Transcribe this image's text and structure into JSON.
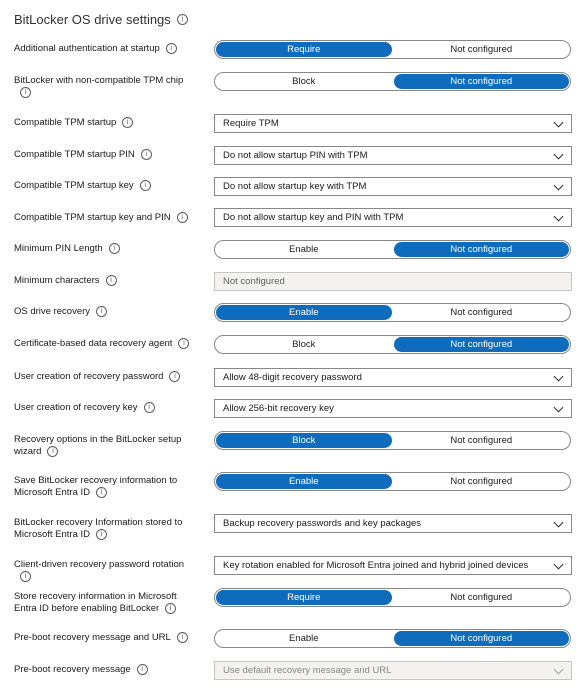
{
  "section": {
    "title": "BitLocker OS drive settings"
  },
  "rows": [
    {
      "label": "Additional authentication at startup",
      "type": "toggle",
      "options": [
        "Require",
        "Not configured"
      ],
      "selected": 0
    },
    {
      "label": "BitLocker with non-compatible TPM chip",
      "type": "toggle",
      "options": [
        "Block",
        "Not configured"
      ],
      "selected": 1
    },
    {
      "label": "Compatible TPM startup",
      "type": "select",
      "value": "Require TPM"
    },
    {
      "label": "Compatible TPM startup PIN",
      "type": "select",
      "value": "Do not allow startup PIN with TPM"
    },
    {
      "label": "Compatible TPM startup key",
      "type": "select",
      "value": "Do not allow startup key with TPM"
    },
    {
      "label": "Compatible TPM startup key and PIN",
      "type": "select",
      "value": "Do not allow startup key and PIN with TPM"
    },
    {
      "label": "Minimum PIN Length",
      "type": "toggle",
      "options": [
        "Enable",
        "Not configured"
      ],
      "selected": 1
    },
    {
      "label": "Minimum characters",
      "type": "textbox",
      "value": "Not configured"
    },
    {
      "label": "OS drive recovery",
      "type": "toggle",
      "options": [
        "Enable",
        "Not configured"
      ],
      "selected": 0
    },
    {
      "label": "Certificate-based data recovery agent",
      "type": "toggle",
      "options": [
        "Block",
        "Not configured"
      ],
      "selected": 1
    },
    {
      "label": "User creation of recovery password",
      "type": "select",
      "value": "Allow 48-digit recovery password"
    },
    {
      "label": "User creation of recovery key",
      "type": "select",
      "value": "Allow 256-bit recovery key"
    },
    {
      "label": "Recovery options in the BitLocker setup wizard",
      "type": "toggle",
      "options": [
        "Block",
        "Not configured"
      ],
      "selected": 0
    },
    {
      "label": "Save BitLocker recovery information to Microsoft Entra ID",
      "type": "toggle",
      "options": [
        "Enable",
        "Not configured"
      ],
      "selected": 0
    },
    {
      "label": "BitLocker recovery Information stored to Microsoft Entra ID",
      "type": "select",
      "value": "Backup recovery passwords and key packages"
    },
    {
      "label": "Client-driven recovery password rotation",
      "type": "select",
      "value": "Key rotation enabled for Microsoft Entra joined and hybrid joined devices"
    },
    {
      "label": "Store recovery information in Microsoft Entra ID before enabling BitLocker",
      "type": "toggle",
      "options": [
        "Require",
        "Not configured"
      ],
      "selected": 0
    },
    {
      "label": "Pre-boot recovery message and URL",
      "type": "toggle",
      "options": [
        "Enable",
        "Not configured"
      ],
      "selected": 1
    },
    {
      "label": "Pre-boot recovery message",
      "type": "select",
      "value": "Use default recovery message and URL",
      "disabled": true
    }
  ],
  "colors": {
    "accent": "#0f6cbd",
    "border": "#8a8886",
    "disabled_bg": "#f3f2f1"
  },
  "icons": {
    "info": "info-icon",
    "dropdown": "chevron-down-icon"
  }
}
